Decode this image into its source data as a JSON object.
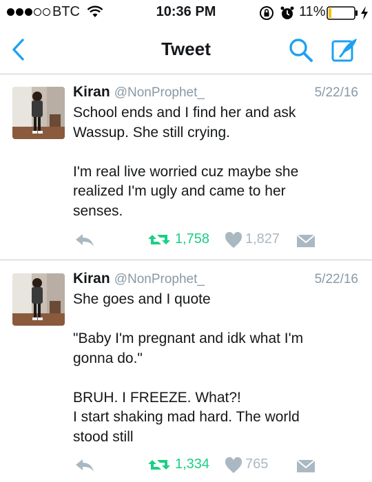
{
  "status_bar": {
    "carrier": "BTC",
    "time": "10:36 PM",
    "battery_percent": "11%",
    "battery_level": 0.11,
    "signal_bars_filled": 3,
    "signal_bars_total": 5
  },
  "nav": {
    "title": "Tweet",
    "back_icon": "chevron-left-icon",
    "search_icon": "search-icon",
    "compose_icon": "compose-icon"
  },
  "colors": {
    "accent": "#1da1f2",
    "retweet": "#19cf86",
    "muted": "#8899a6",
    "icon_gray": "#aab8c2"
  },
  "tweets": [
    {
      "name": "Kiran",
      "handle": "@NonProphet_",
      "date": "5/22/16",
      "lines": [
        "School ends and I find her and ask",
        "Wassup. She still crying.",
        "I'm real live worried cuz maybe she",
        "realized I'm ugly and came to her",
        "senses."
      ],
      "retweets": "1,758",
      "likes": "1,827"
    },
    {
      "name": "Kiran",
      "handle": "@NonProphet_",
      "date": "5/22/16",
      "lines": [
        "She goes and I quote",
        "\"Baby I'm pregnant and idk what I'm",
        "gonna do.\"",
        "BRUH. I FREEZE. What?!",
        "I start shaking mad hard. The world",
        "stood still"
      ],
      "retweets": "1,334",
      "likes": "765"
    }
  ]
}
